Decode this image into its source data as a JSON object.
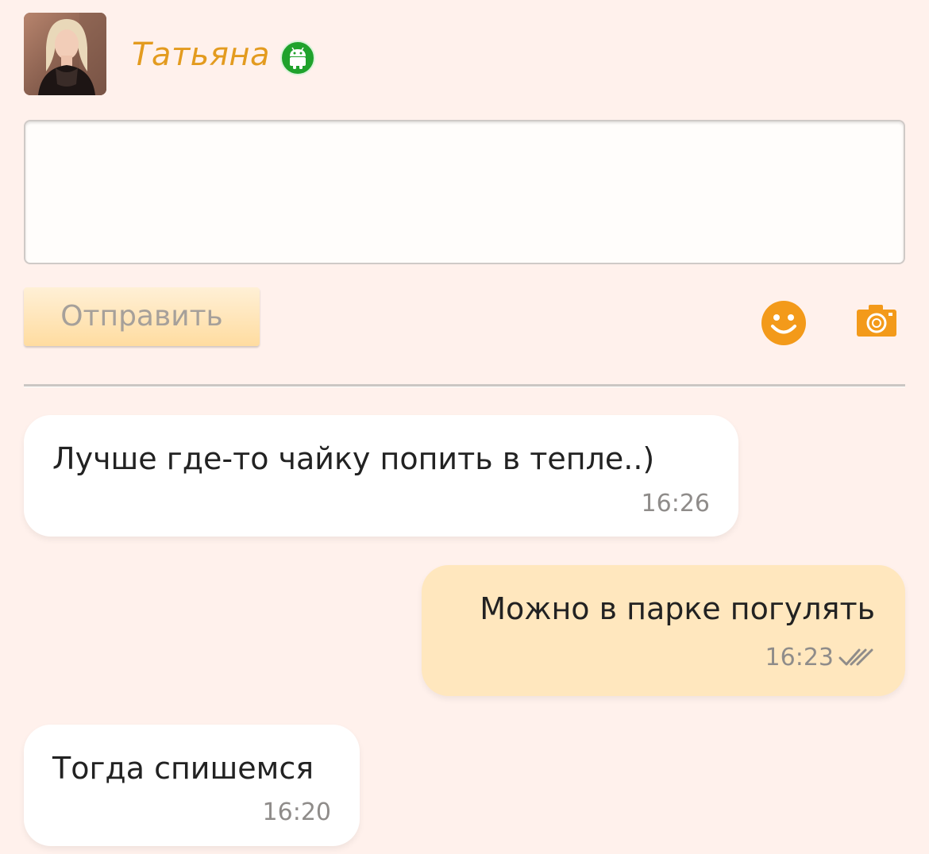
{
  "header": {
    "contact_name": "Татьяна",
    "status_icon": "android-icon",
    "status_color": "#1fa22c"
  },
  "composer": {
    "input_value": "",
    "send_label": "Отправить",
    "emoji_icon": "smiley-icon",
    "photo_icon": "camera-icon",
    "accent_color": "#f39a1a"
  },
  "messages": [
    {
      "direction": "incoming",
      "text": "Лучше где-то чайку попить в тепле..)",
      "time": "16:26"
    },
    {
      "direction": "outgoing",
      "text": "Можно в парке погулять",
      "time": "16:23",
      "read_status": "double-check-icon"
    },
    {
      "direction": "incoming",
      "text": "Тогда спишемся",
      "time": "16:20"
    }
  ]
}
